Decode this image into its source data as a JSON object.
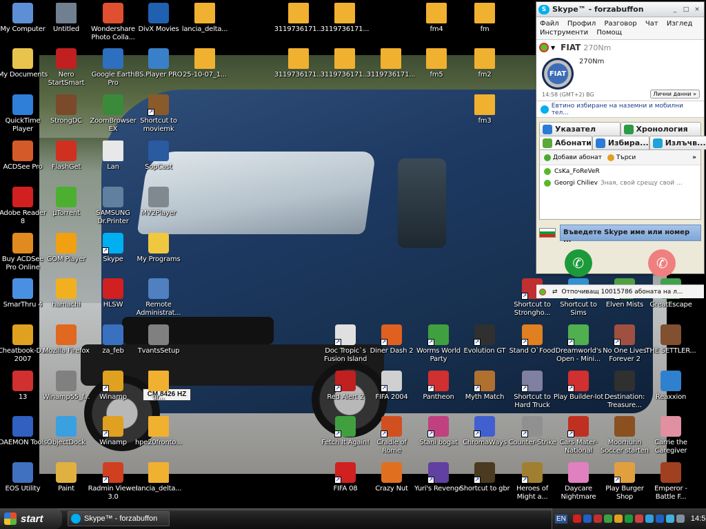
{
  "desktop": {
    "icons": [
      {
        "label": "My Computer",
        "icon": "computer-icon",
        "color": "#5d8fd6",
        "shortcut": false
      },
      {
        "label": "My Documents",
        "icon": "folder-documents-icon",
        "color": "#e9c44c",
        "shortcut": false
      },
      {
        "label": "QuickTime Player",
        "icon": "quicktime-icon",
        "color": "#2f7fd9",
        "shortcut": false
      },
      {
        "label": "ACDSee Pro",
        "icon": "acdsee-icon",
        "color": "#d55a2a",
        "shortcut": false
      },
      {
        "label": "Adobe Reader 8",
        "icon": "adobe-reader-icon",
        "color": "#d02020",
        "shortcut": false
      },
      {
        "label": "Buy ACDSee Pro Online",
        "icon": "shopping-icon",
        "color": "#e08a20",
        "shortcut": false
      },
      {
        "label": "SmarThru 4",
        "icon": "smarthru-icon",
        "color": "#4a90e2",
        "shortcut": false
      },
      {
        "label": "Cheatbook-D... 2007",
        "icon": "cheatbook-icon",
        "color": "#e0a020",
        "shortcut": false
      },
      {
        "label": "13",
        "icon": "pdf-icon",
        "color": "#d03030",
        "shortcut": false
      },
      {
        "label": "DAEMON Tools",
        "icon": "daemon-tools-icon",
        "color": "#3060c0",
        "shortcut": false
      },
      {
        "label": "EOS Utility",
        "icon": "eos-utility-icon",
        "color": "#4070c0",
        "shortcut": false
      },
      {
        "label": "Untitled",
        "icon": "video-file-icon",
        "color": "#708090",
        "shortcut": false
      },
      {
        "label": "Nero StartSmart",
        "icon": "nero-icon",
        "color": "#c02020",
        "shortcut": false
      },
      {
        "label": "StrongDC",
        "icon": "strongdc-icon",
        "color": "#7a4a2a",
        "shortcut": false
      },
      {
        "label": "FlashGet",
        "icon": "flashget-icon",
        "color": "#d03020",
        "shortcut": false
      },
      {
        "label": "µTorrent",
        "icon": "utorrent-icon",
        "color": "#4caf30",
        "shortcut": false
      },
      {
        "label": "GOM Player",
        "icon": "gom-player-icon",
        "color": "#f0a010",
        "shortcut": false
      },
      {
        "label": "hamachi",
        "icon": "hamachi-icon",
        "color": "#f0b020",
        "shortcut": false
      },
      {
        "label": "Mozilla Firefox",
        "icon": "firefox-icon",
        "color": "#e06820",
        "shortcut": false
      },
      {
        "label": "Winamp55_f...",
        "icon": "installer-icon",
        "color": "#808080",
        "shortcut": false
      },
      {
        "label": "ObjectDock",
        "icon": "objectdock-icon",
        "color": "#3aa0e0",
        "shortcut": false
      },
      {
        "label": "Paint",
        "icon": "paint-icon",
        "color": "#e0b040",
        "shortcut": false
      },
      {
        "label": "Wondershare Photo Colla...",
        "icon": "wondershare-icon",
        "color": "#e05030",
        "shortcut": false
      },
      {
        "label": "Google Earth Pro",
        "icon": "google-earth-icon",
        "color": "#2f6fbf",
        "shortcut": false
      },
      {
        "label": "ZoomBrowser EX",
        "icon": "zoombrowser-icon",
        "color": "#3a8a3a",
        "shortcut": false
      },
      {
        "label": "Lan",
        "icon": "text-file-icon",
        "color": "#e8e8e8",
        "shortcut": false
      },
      {
        "label": "SAMSUNG Dr.Printer",
        "icon": "printer-icon",
        "color": "#6080a0",
        "shortcut": false
      },
      {
        "label": "Skype",
        "icon": "skype-shortcut-icon",
        "color": "#00aff0",
        "shortcut": true
      },
      {
        "label": "HLSW",
        "icon": "hlsw-icon",
        "color": "#d02020",
        "shortcut": false
      },
      {
        "label": "za_feb",
        "icon": "document-icon",
        "color": "#3a70c0",
        "shortcut": false
      },
      {
        "label": "Winamp",
        "icon": "winamp-icon",
        "color": "#e0a020",
        "shortcut": true
      },
      {
        "label": "Winamp",
        "icon": "winamp-icon",
        "color": "#e0a020",
        "shortcut": true
      },
      {
        "label": "Radmin Viewer 3.0",
        "icon": "radmin-icon",
        "color": "#d04020",
        "shortcut": true
      },
      {
        "label": "DivX Movies",
        "icon": "divx-icon",
        "color": "#2060b0",
        "shortcut": false
      },
      {
        "label": "BS.Player PRO",
        "icon": "bsplayer-icon",
        "color": "#3a80c8",
        "shortcut": false
      },
      {
        "label": "Shortcut to moviemk",
        "icon": "moviemaker-icon",
        "color": "#8a5a2a",
        "shortcut": true
      },
      {
        "label": "SopCast",
        "icon": "sopcast-icon",
        "color": "#2a5aa0",
        "shortcut": false
      },
      {
        "label": "MV2Player",
        "icon": "mv2player-icon",
        "color": "#808890",
        "shortcut": false
      },
      {
        "label": "My Programs",
        "icon": "folder-icon",
        "color": "#f0c840",
        "shortcut": false
      },
      {
        "label": "Remote Administrat...",
        "icon": "remote-admin-icon",
        "color": "#5080c0",
        "shortcut": false
      },
      {
        "label": "TvantsSetup",
        "icon": "installer-icon",
        "color": "#808080",
        "shortcut": false
      },
      {
        "label": "qr...",
        "icon": "image-file-icon",
        "color": "#f0b030",
        "shortcut": false
      },
      {
        "label": "hpe20fronto...",
        "icon": "image-file-icon",
        "color": "#f0b030",
        "shortcut": false
      },
      {
        "label": "lancia_delta...",
        "icon": "image-file-icon",
        "color": "#f0b030",
        "shortcut": false
      },
      {
        "label": "lancia_delta...",
        "icon": "image-file-icon",
        "color": "#f0b030",
        "shortcut": false
      },
      {
        "label": "25-10-07_1...",
        "icon": "image-file-icon",
        "color": "#f0b030",
        "shortcut": false
      },
      {
        "label": "3119736171...",
        "icon": "image-file-icon",
        "color": "#f0b030",
        "shortcut": false
      },
      {
        "label": "3119736171...",
        "icon": "image-file-icon",
        "color": "#f0b030",
        "shortcut": false
      },
      {
        "label": "3119736171...",
        "icon": "image-file-icon",
        "color": "#f0b030",
        "shortcut": false
      },
      {
        "label": "3119736171...",
        "icon": "image-file-icon",
        "color": "#f0b030",
        "shortcut": false
      },
      {
        "label": "3119736171...",
        "icon": "image-file-icon",
        "color": "#f0b030",
        "shortcut": false
      },
      {
        "label": "fm4",
        "icon": "image-file-icon",
        "color": "#f0b030",
        "shortcut": false
      },
      {
        "label": "fm",
        "icon": "image-file-icon",
        "color": "#f0b030",
        "shortcut": false
      },
      {
        "label": "fm5",
        "icon": "image-file-icon",
        "color": "#f0b030",
        "shortcut": false
      },
      {
        "label": "fm2",
        "icon": "image-file-icon",
        "color": "#f0b030",
        "shortcut": false
      },
      {
        "label": "fm3",
        "icon": "image-file-icon",
        "color": "#f0b030",
        "shortcut": false
      },
      {
        "label": "Doc Tropic`s Fusion Island",
        "icon": "game-icon",
        "color": "#e0e0e0",
        "shortcut": true
      },
      {
        "label": "Diner Dash 2",
        "icon": "game-icon",
        "color": "#e06020",
        "shortcut": true
      },
      {
        "label": "Worms World Party",
        "icon": "game-icon",
        "color": "#40a040",
        "shortcut": true
      },
      {
        "label": "Evolution GT",
        "icon": "game-icon",
        "color": "#303030",
        "shortcut": true
      },
      {
        "label": "Stand O`Food",
        "icon": "game-icon",
        "color": "#e08020",
        "shortcut": true
      },
      {
        "label": "Dreamworld's Open - Mini...",
        "icon": "game-icon",
        "color": "#50b050",
        "shortcut": true
      },
      {
        "label": "No One Lives Forever 2",
        "icon": "game-icon",
        "color": "#a05040",
        "shortcut": true
      },
      {
        "label": "THE SETTLER...",
        "icon": "game-icon",
        "color": "#805030",
        "shortcut": false
      },
      {
        "label": "Red Alert 2",
        "icon": "game-icon",
        "color": "#c02020",
        "shortcut": true
      },
      {
        "label": "FIFA 2004",
        "icon": "game-icon",
        "color": "#d0d0d0",
        "shortcut": true
      },
      {
        "label": "Pantheon",
        "icon": "game-icon",
        "color": "#d03030",
        "shortcut": true
      },
      {
        "label": "Myth Match",
        "icon": "game-icon",
        "color": "#b07030",
        "shortcut": true
      },
      {
        "label": "Shortcut to Hard Truck",
        "icon": "game-icon",
        "color": "#8080a0",
        "shortcut": true
      },
      {
        "label": "Play Builder-Iot",
        "icon": "game-icon",
        "color": "#d03030",
        "shortcut": true
      },
      {
        "label": "Destination: Treasure...",
        "icon": "game-icon",
        "color": "#303030",
        "shortcut": false
      },
      {
        "label": "Reaxxion",
        "icon": "game-icon",
        "color": "#3080d0",
        "shortcut": false
      },
      {
        "label": "Fetch It Again!",
        "icon": "game-icon",
        "color": "#40a040",
        "shortcut": true
      },
      {
        "label": "Cradle of Rome",
        "icon": "game-icon",
        "color": "#d05020",
        "shortcut": true
      },
      {
        "label": "Stani bogat",
        "icon": "game-icon",
        "color": "#c04080",
        "shortcut": true
      },
      {
        "label": "ChromaWays",
        "icon": "game-icon",
        "color": "#4060d0",
        "shortcut": true
      },
      {
        "label": "Counter-Strike",
        "icon": "game-icon",
        "color": "#909090",
        "shortcut": true
      },
      {
        "label": "Cars Mater-National",
        "icon": "game-icon",
        "color": "#c03020",
        "shortcut": true
      },
      {
        "label": "Moorhuhn Soccer starten",
        "icon": "game-icon",
        "color": "#8a5020",
        "shortcut": false
      },
      {
        "label": "Carrie the Caregiver",
        "icon": "game-icon",
        "color": "#e090a0",
        "shortcut": false
      },
      {
        "label": "FIFA 08",
        "icon": "game-icon",
        "color": "#d02020",
        "shortcut": true
      },
      {
        "label": "Crazy Nut",
        "icon": "game-icon",
        "color": "#e07020",
        "shortcut": false
      },
      {
        "label": "Yuri's Revenge",
        "icon": "game-icon",
        "color": "#6040a0",
        "shortcut": true
      },
      {
        "label": "Shortcut to gbr",
        "icon": "game-icon",
        "color": "#4a3a20",
        "shortcut": true
      },
      {
        "label": "Heroes of Might a...",
        "icon": "game-icon",
        "color": "#a08030",
        "shortcut": true
      },
      {
        "label": "Daycare Nightmare",
        "icon": "game-icon",
        "color": "#e080c0",
        "shortcut": false
      },
      {
        "label": "Play Burger Shop",
        "icon": "game-icon",
        "color": "#e0a040",
        "shortcut": true
      },
      {
        "label": "Emperor - Battle F...",
        "icon": "game-icon",
        "color": "#a04020",
        "shortcut": false
      },
      {
        "label": "Shortcut to Strongho...",
        "icon": "game-icon",
        "color": "#c03030",
        "shortcut": true
      },
      {
        "label": "Shortcut to Sims",
        "icon": "game-icon",
        "color": "#3090d0",
        "shortcut": true
      },
      {
        "label": "Elven Mists",
        "icon": "game-icon",
        "color": "#50a040",
        "shortcut": true
      },
      {
        "label": "GreatEscape",
        "icon": "game-icon",
        "color": "#40a050",
        "shortcut": false
      }
    ],
    "plate_text": "CM 8426 HZ"
  },
  "skype": {
    "title": "Skype™ - forzabuffon",
    "logo_text": "S",
    "win_min": "_",
    "win_max": "□",
    "win_close": "×",
    "menu": [
      "Файл",
      "Профил",
      "Разговор",
      "Чат",
      "Изглед",
      "Инструменти",
      "Помощ"
    ],
    "profile": {
      "name": "FIAT",
      "mood": "270Nm",
      "avatar_text": "FIAT",
      "mood_box": "270Nm",
      "time": "14:58 (GMT+2) BG",
      "personal_button": "Лични данни »"
    },
    "promo": "Евтино избиране на наземни и мобилни тел...",
    "tabs_row1": [
      {
        "label": "Указател",
        "icon": "directory-icon",
        "color": "#2c7bd6"
      },
      {
        "label": "Хронология",
        "icon": "history-icon",
        "color": "#2c9a46"
      }
    ],
    "tabs_row2": [
      {
        "label": "Абонати",
        "icon": "contacts-icon",
        "color": "#5aa93a"
      },
      {
        "label": "Избира...",
        "icon": "dialer-icon",
        "color": "#2c7bd6"
      },
      {
        "label": "Излъчв...",
        "icon": "broadcast-icon",
        "color": "#1fa3d8"
      }
    ],
    "add_contact": "Добави абонат",
    "search": "Търси",
    "more": "»",
    "contacts": [
      {
        "name": "CsKa_FoReVeR",
        "mood": ""
      },
      {
        "name": "Georgi Chiliev",
        "mood": "Зная, свой срещу свой ..."
      }
    ],
    "input_placeholder": "Въведете Skype име или номер ...",
    "status_text": "Отпочиващ  10015786 абоната на л...",
    "call_glyph": "✆",
    "hangup_glyph": "✆",
    "colors": {
      "call": "#1c9a3a",
      "hangup": "#f08080"
    }
  },
  "taskbar": {
    "start_label": "start",
    "task_label": "Skype™ - forzabuffon",
    "language": "EN",
    "clock": "14:58",
    "tray_icons": [
      "#d02020",
      "#2060c0",
      "#c03030",
      "#40a040",
      "#e0a020",
      "#1c9a3a",
      "#d04040",
      "#30a0e0",
      "#2060c0",
      "#40b0e0",
      "#8090a0"
    ]
  }
}
